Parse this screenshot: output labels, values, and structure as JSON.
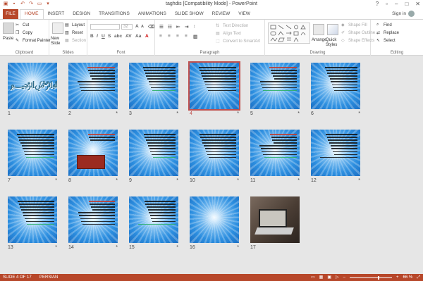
{
  "window": {
    "title": "taghdis [Compatibility Mode] - PowerPoint"
  },
  "tabs": {
    "file": "FILE",
    "items": [
      "HOME",
      "INSERT",
      "DESIGN",
      "TRANSITIONS",
      "ANIMATIONS",
      "SLIDE SHOW",
      "REVIEW",
      "VIEW"
    ],
    "active": "HOME",
    "signin": "Sign in"
  },
  "ribbon": {
    "clipboard": {
      "label": "Clipboard",
      "paste": "Paste",
      "cut": "Cut",
      "copy": "Copy",
      "format_painter": "Format Painter"
    },
    "slides": {
      "label": "Slides",
      "new_slide": "New Slide",
      "layout": "Layout",
      "reset": "Reset",
      "section": "Section"
    },
    "font": {
      "label": "Font",
      "size": "32"
    },
    "paragraph": {
      "label": "Paragraph",
      "text_direction": "Text Direction",
      "align_text": "Align Text",
      "convert": "Convert to SmartArt"
    },
    "drawing": {
      "label": "Drawing",
      "arrange": "Arrange",
      "quick_styles": "Quick Styles",
      "shape_fill": "Shape Fill",
      "shape_outline": "Shape Outline",
      "shape_effects": "Shape Effects"
    },
    "editing": {
      "label": "Editing",
      "find": "Find",
      "replace": "Replace",
      "select": "Select"
    }
  },
  "slides": [
    {
      "num": "1",
      "kind": "calligraphy",
      "star": false
    },
    {
      "num": "2",
      "kind": "text",
      "star": true
    },
    {
      "num": "3",
      "kind": "text",
      "star": true
    },
    {
      "num": "4",
      "kind": "text",
      "star": true,
      "selected": true
    },
    {
      "num": "5",
      "kind": "text",
      "star": true
    },
    {
      "num": "6",
      "kind": "text",
      "star": true
    },
    {
      "num": "7",
      "kind": "text",
      "star": true
    },
    {
      "num": "8",
      "kind": "image",
      "star": true
    },
    {
      "num": "9",
      "kind": "text",
      "star": true
    },
    {
      "num": "10",
      "kind": "text",
      "star": true
    },
    {
      "num": "11",
      "kind": "text",
      "star": true
    },
    {
      "num": "12",
      "kind": "text",
      "star": true
    },
    {
      "num": "13",
      "kind": "text",
      "star": true
    },
    {
      "num": "14",
      "kind": "text",
      "star": true
    },
    {
      "num": "15",
      "kind": "text",
      "star": true
    },
    {
      "num": "16",
      "kind": "blank",
      "star": true
    },
    {
      "num": "17",
      "kind": "laptop",
      "star": false
    }
  ],
  "status": {
    "slide_info": "SLIDE 4 OF 17",
    "language": "PERSIAN",
    "zoom": "66 %"
  },
  "colors": {
    "accent": "#b7472a",
    "selection": "#c0504d"
  }
}
